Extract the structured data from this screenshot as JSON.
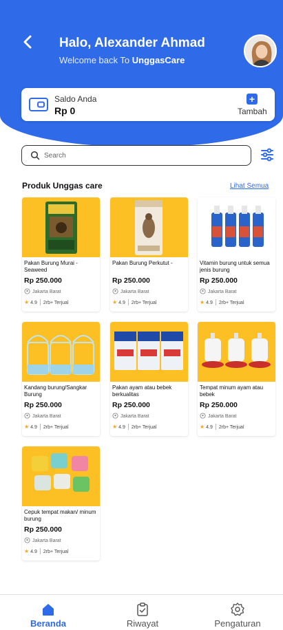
{
  "header": {
    "greeting": "Halo, Alexander Ahmad",
    "welcome_prefix": "Welcome back To ",
    "app_name": "UnggasCare"
  },
  "saldo": {
    "label": "Saldo Anda",
    "value": "Rp 0",
    "add_label": "Tambah"
  },
  "search": {
    "placeholder": "Search"
  },
  "section": {
    "title": "Produk Unggas care",
    "see_all": "Lihat Semua"
  },
  "products": [
    {
      "name": "Pakan Burung Murai - Seaweed",
      "price": "Rp 250.000",
      "location": "Jakarta Barat",
      "rating": "4.9",
      "sold": "2rb+ Terjual"
    },
    {
      "name": "Pakan Burung Perkutut -",
      "price": "Rp 250.000",
      "location": "Jakarta Barat",
      "rating": "4.9",
      "sold": "2rb+ Terjual"
    },
    {
      "name": "Vitamin burung untuk semua jenis burung",
      "price": "Rp 250.000",
      "location": "Jakarta Barat",
      "rating": "4.9",
      "sold": "2rb+ Terjual"
    },
    {
      "name": "Kandang burung/Sangkar Burung",
      "price": "Rp 250.000",
      "location": "Jakarta Barat",
      "rating": "4.9",
      "sold": "2rb+ Terjual"
    },
    {
      "name": "Pakan ayam atau bebek berkualitas",
      "price": "Rp 250.000",
      "location": "Jakarta Barat",
      "rating": "4.9",
      "sold": "2rb+ Terjual"
    },
    {
      "name": "Tempat minum ayam atau bebek",
      "price": "Rp 250.000",
      "location": "Jakarta Barat",
      "rating": "4.9",
      "sold": "2rb+ Terjual"
    },
    {
      "name": "Cepuk  tempat makan/ minum burung",
      "price": "Rp 250.000",
      "location": "Jakarta Barat",
      "rating": "4.9",
      "sold": "2rb+ Terjual"
    }
  ],
  "nav": {
    "home": "Beranda",
    "history": "Riwayat",
    "settings": "Pengaturan"
  },
  "colors": {
    "primary": "#2f6ae8",
    "product_bg": "#fcbf24",
    "star": "#f1a81c"
  }
}
